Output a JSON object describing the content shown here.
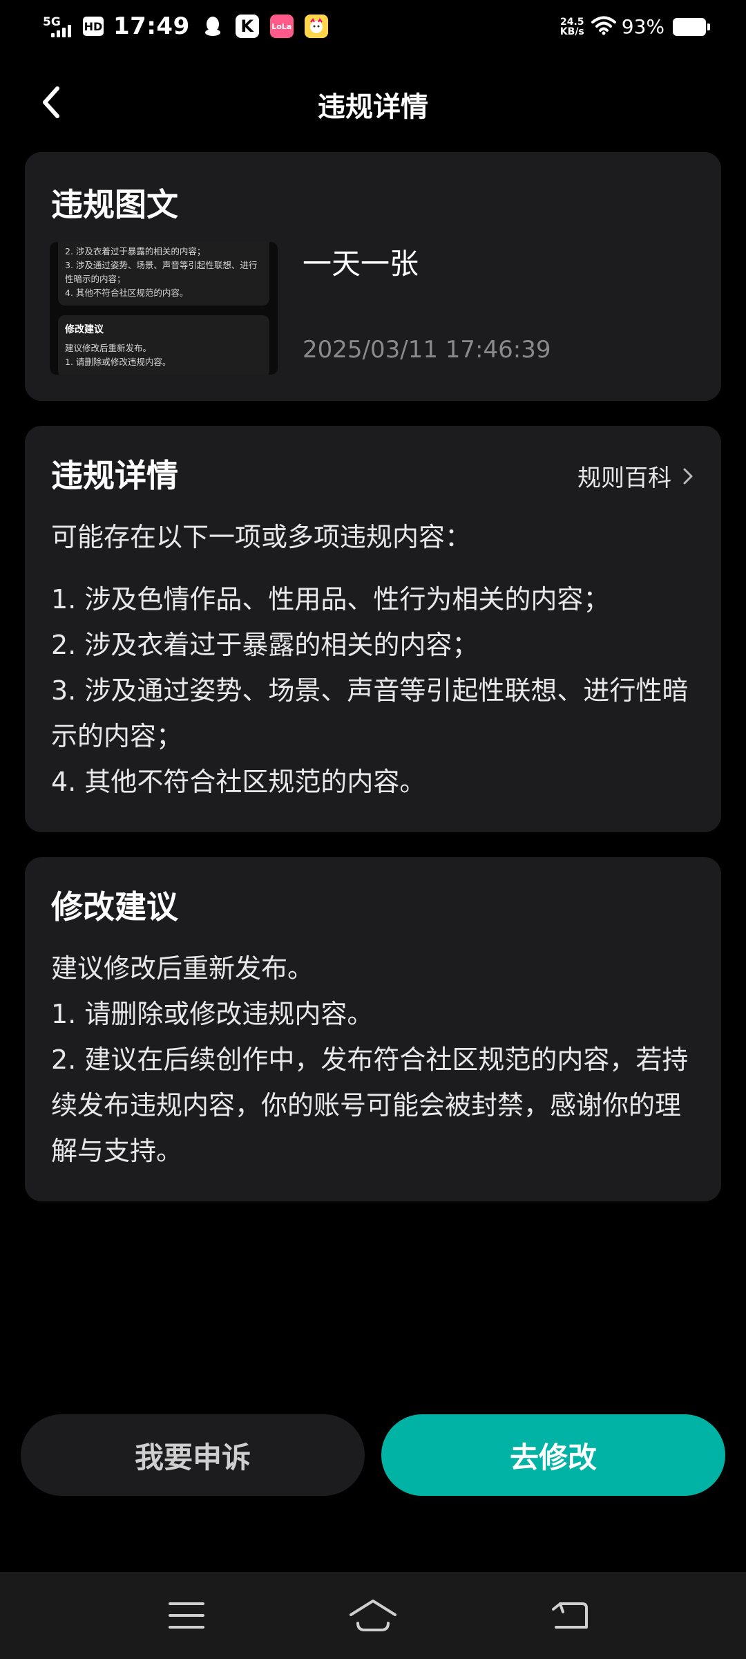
{
  "status_bar": {
    "network": "5G",
    "hd": "HD",
    "time": "17:49",
    "app_icons": [
      "qq-icon",
      "k-app-icon",
      "lola-app-icon",
      "cat-app-icon"
    ],
    "k_label": "K",
    "lola_label": "LoLa",
    "speed_value": "24.5",
    "speed_unit": "KB/s",
    "battery_percent": "93%"
  },
  "header": {
    "title": "违规详情",
    "back_icon": "chevron-left-icon"
  },
  "violating_post": {
    "title": "违规图文",
    "thumbnail_lines": [
      "2. 涉及衣着过于暴露的相关的内容；",
      "3. 涉及通过姿势、场景、声音等引起性联想、进行",
      "性暗示的内容；",
      "4. 其他不符合社区规范的内容。"
    ],
    "thumbnail_heading": "修改建议",
    "thumbnail_lines_2": [
      "建议修改后重新发布。",
      "1. 请删除或修改违规内容。"
    ],
    "post_title": "一天一张",
    "post_time": "2025/03/11 17:46:39"
  },
  "violation_details": {
    "title": "违规详情",
    "rules_link": "规则百科",
    "intro": "可能存在以下一项或多项违规内容：",
    "items": [
      "1. 涉及色情作品、性用品、性行为相关的内容；",
      "2. 涉及衣着过于暴露的相关的内容；",
      "3. 涉及通过姿势、场景、声音等引起性联想、进行性暗示的内容；",
      "4. 其他不符合社区规范的内容。"
    ]
  },
  "suggestions": {
    "title": "修改建议",
    "lines": [
      "建议修改后重新发布。",
      "1. 请删除或修改违规内容。",
      "2. 建议在后续创作中，发布符合社区规范的内容，若持续发布违规内容，你的账号可能会被封禁，感谢你的理解与支持。"
    ]
  },
  "actions": {
    "appeal": "我要申诉",
    "edit": "去修改",
    "accent_color": "#00b3a4"
  },
  "nav_bar": {
    "icons": [
      "menu-icon",
      "home-icon",
      "back-icon"
    ]
  }
}
